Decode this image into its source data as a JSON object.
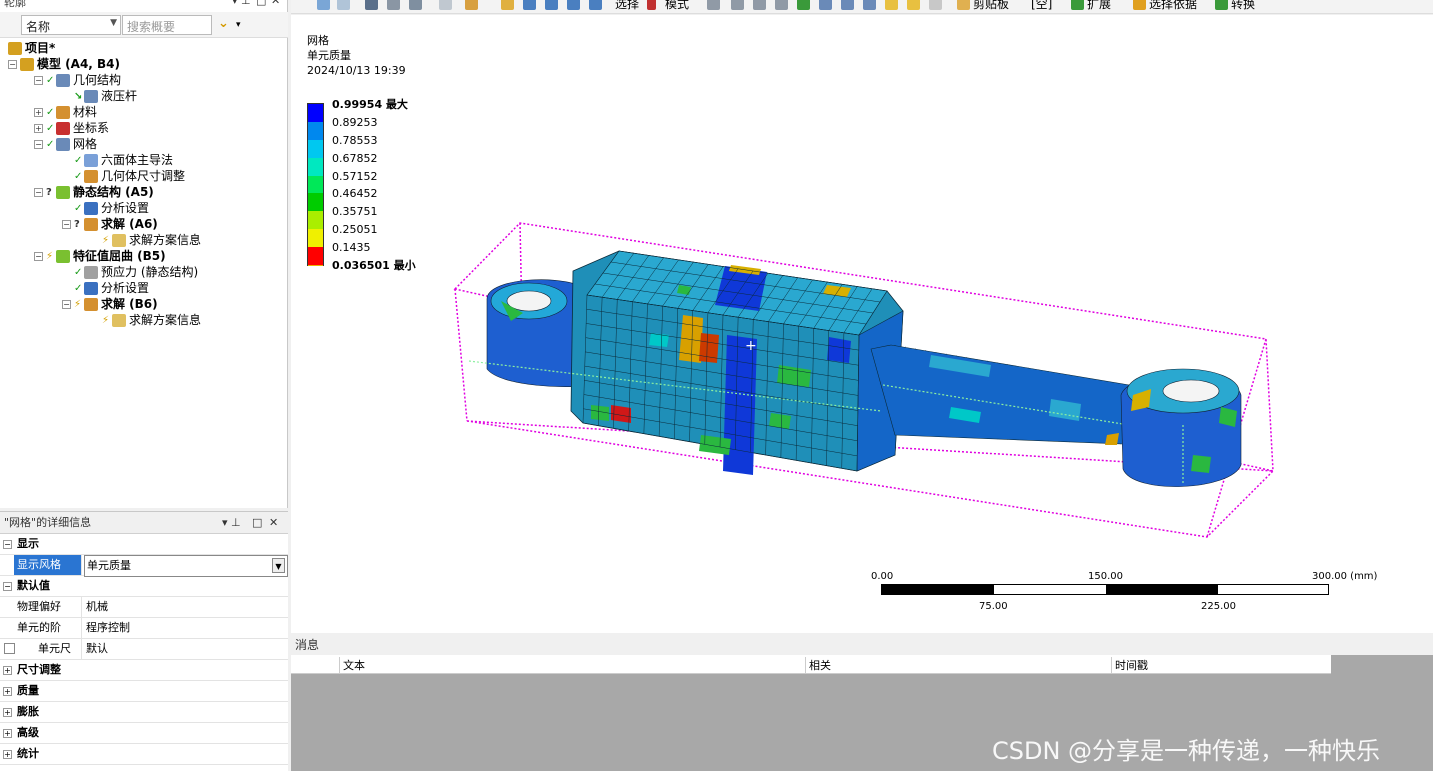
{
  "outline": {
    "title": "轮廓",
    "filter_name": "名称",
    "search_placeholder": "搜索概要",
    "tree": [
      {
        "label": "项目*",
        "bold": true
      },
      {
        "label": "模型 (A4, B4)",
        "bold": true
      },
      {
        "label": "几何结构",
        "bold": false
      },
      {
        "label": "液压杆",
        "bold": false
      },
      {
        "label": "材料",
        "bold": false
      },
      {
        "label": "坐标系",
        "bold": false
      },
      {
        "label": "网格",
        "bold": false
      },
      {
        "label": "六面体主导法",
        "bold": false
      },
      {
        "label": "几何体尺寸调整",
        "bold": false
      },
      {
        "label": "静态结构 (A5)",
        "bold": true
      },
      {
        "label": "分析设置",
        "bold": false
      },
      {
        "label": "求解 (A6)",
        "bold": true
      },
      {
        "label": "求解方案信息",
        "bold": false
      },
      {
        "label": "特征值屈曲 (B5)",
        "bold": true
      },
      {
        "label": "预应力 (静态结构)",
        "bold": false
      },
      {
        "label": "分析设置",
        "bold": false
      },
      {
        "label": "求解 (B6)",
        "bold": true
      },
      {
        "label": "求解方案信息",
        "bold": false
      }
    ]
  },
  "details": {
    "title": "\"网格\"的详细信息",
    "rows": [
      {
        "type": "group",
        "label": "显示",
        "expanded": true
      },
      {
        "type": "prop",
        "key": "显示风格",
        "value": "单元质量",
        "selected": true
      },
      {
        "type": "group",
        "label": "默认值",
        "expanded": true
      },
      {
        "type": "prop",
        "key": "物理偏好",
        "value": "机械"
      },
      {
        "type": "prop",
        "key": "单元的阶",
        "value": "程序控制"
      },
      {
        "type": "check",
        "key": "单元尺寸",
        "value": "默认"
      },
      {
        "type": "group",
        "label": "尺寸调整",
        "expanded": false
      },
      {
        "type": "group",
        "label": "质量",
        "expanded": false
      },
      {
        "type": "group",
        "label": "膨胀",
        "expanded": false
      },
      {
        "type": "group",
        "label": "高级",
        "expanded": false
      },
      {
        "type": "group",
        "label": "统计",
        "expanded": false
      }
    ]
  },
  "toolbar": {
    "select": "选择",
    "mode": "模式",
    "clipboard": "剪贴板",
    "empty": "[空]",
    "expand": "扩展",
    "select_by": "选择依据",
    "convert": "转换"
  },
  "viewport": {
    "title": "网格",
    "subtitle": "单元质量",
    "timestamp": "2024/10/13 19:39",
    "legend": [
      {
        "value": "0.99954 最大",
        "color": "#0000ff"
      },
      {
        "value": "0.89253",
        "color": "#0088ee"
      },
      {
        "value": "0.78553",
        "color": "#00c8f0"
      },
      {
        "value": "0.67852",
        "color": "#00e8c0"
      },
      {
        "value": "0.57152",
        "color": "#00e858"
      },
      {
        "value": "0.46452",
        "color": "#00cc00"
      },
      {
        "value": "0.35751",
        "color": "#aaee00"
      },
      {
        "value": "0.25051",
        "color": "#f0f000"
      },
      {
        "value": "0.1435",
        "color": "#f0b000"
      },
      {
        "value": "0.036501 最小",
        "color": "#ff0000"
      }
    ],
    "scale": {
      "top_labels": [
        "0.00",
        "150.00",
        "300.00 (mm)"
      ],
      "bottom_labels": [
        "75.00",
        "225.00"
      ]
    }
  },
  "messages": {
    "title": "消息",
    "columns": [
      "文本",
      "相关",
      "时间戳"
    ]
  },
  "watermark": "CSDN @分享是一种传递，一种快乐"
}
